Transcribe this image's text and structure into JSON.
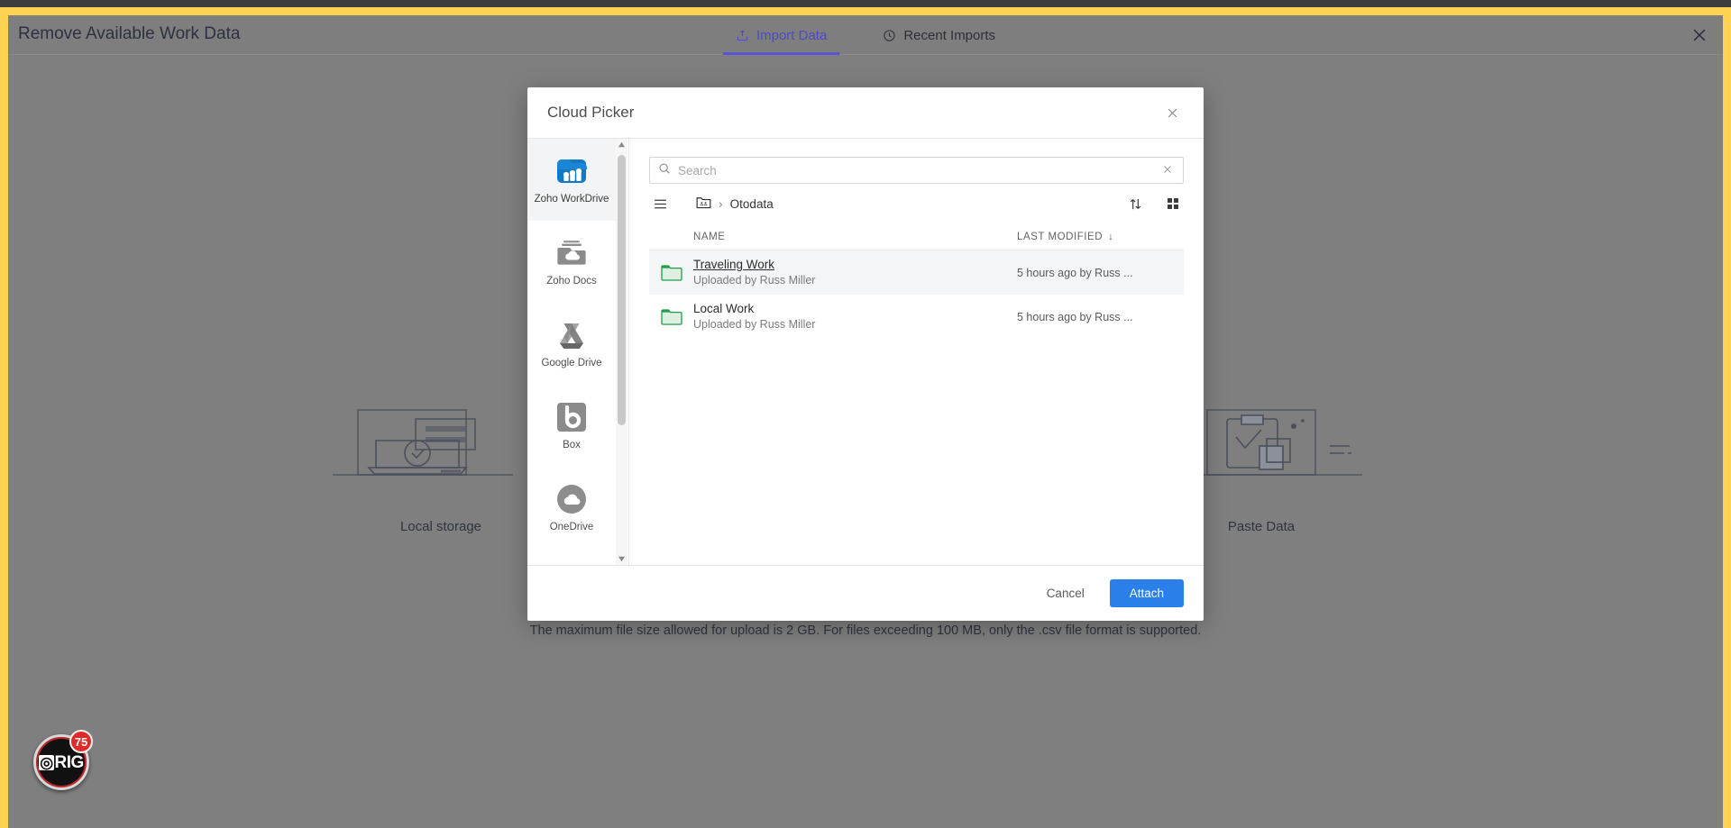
{
  "header": {
    "title": "Remove Available Work Data",
    "tabs": [
      {
        "label": "Import Data",
        "icon": "upload-icon",
        "active": true
      },
      {
        "label": "Recent Imports",
        "icon": "clock-icon",
        "active": false
      }
    ],
    "close_label": "×"
  },
  "background": {
    "illustrations": [
      {
        "caption": "Local storage",
        "icon": "laptop-check-illustration"
      },
      {
        "caption": "Paste Data",
        "icon": "paste-data-illustration"
      }
    ],
    "upload_note": "The maximum file size allowed for upload is 2 GB. For files exceeding 100 MB, only the .csv file format is supported."
  },
  "rig_widget": {
    "brand": "RIG",
    "count": "75"
  },
  "modal": {
    "title": "Cloud Picker",
    "close_label": "×",
    "services": [
      {
        "label": "Zoho WorkDrive",
        "icon": "zoho-workdrive-icon",
        "active": true
      },
      {
        "label": "Zoho Docs",
        "icon": "zoho-docs-icon",
        "active": false
      },
      {
        "label": "Google Drive",
        "icon": "google-drive-icon",
        "active": false
      },
      {
        "label": "Box",
        "icon": "box-icon",
        "active": false
      },
      {
        "label": "OneDrive",
        "icon": "onedrive-icon",
        "active": false
      }
    ],
    "search": {
      "value": "",
      "placeholder": "Search",
      "icon": "search-icon",
      "clear_label": "×"
    },
    "toolbar": {
      "menu_icon": "hamburger-menu-icon",
      "team_folder_icon": "team-folder-icon",
      "crumb_separator": "›",
      "current_folder": "Otodata",
      "sort_icon": "sort-arrows-icon",
      "grid_view_icon": "grid-view-icon"
    },
    "table": {
      "columns": [
        {
          "label": "NAME"
        },
        {
          "label": "LAST MODIFIED",
          "sort_indicator": "↓"
        }
      ],
      "rows": [
        {
          "name": "Traveling Work",
          "sub": "Uploaded by Russ Miller",
          "last_modified": "5 hours ago by Russ ...",
          "icon": "folder-icon",
          "hovered": true
        },
        {
          "name": "Local Work",
          "sub": "Uploaded by Russ Miller",
          "last_modified": "5 hours ago by Russ ...",
          "icon": "folder-icon",
          "hovered": false
        }
      ]
    },
    "footer": {
      "cancel_label": "Cancel",
      "attach_label": "Attach"
    }
  },
  "colors": {
    "frame": "#fdd351",
    "accent": "#5a52d5",
    "primary_button": "#2a7fe8",
    "folder_green": "#1e9e4a",
    "workdrive_blue": "#1479c4",
    "badge_red": "#e02a2a"
  }
}
